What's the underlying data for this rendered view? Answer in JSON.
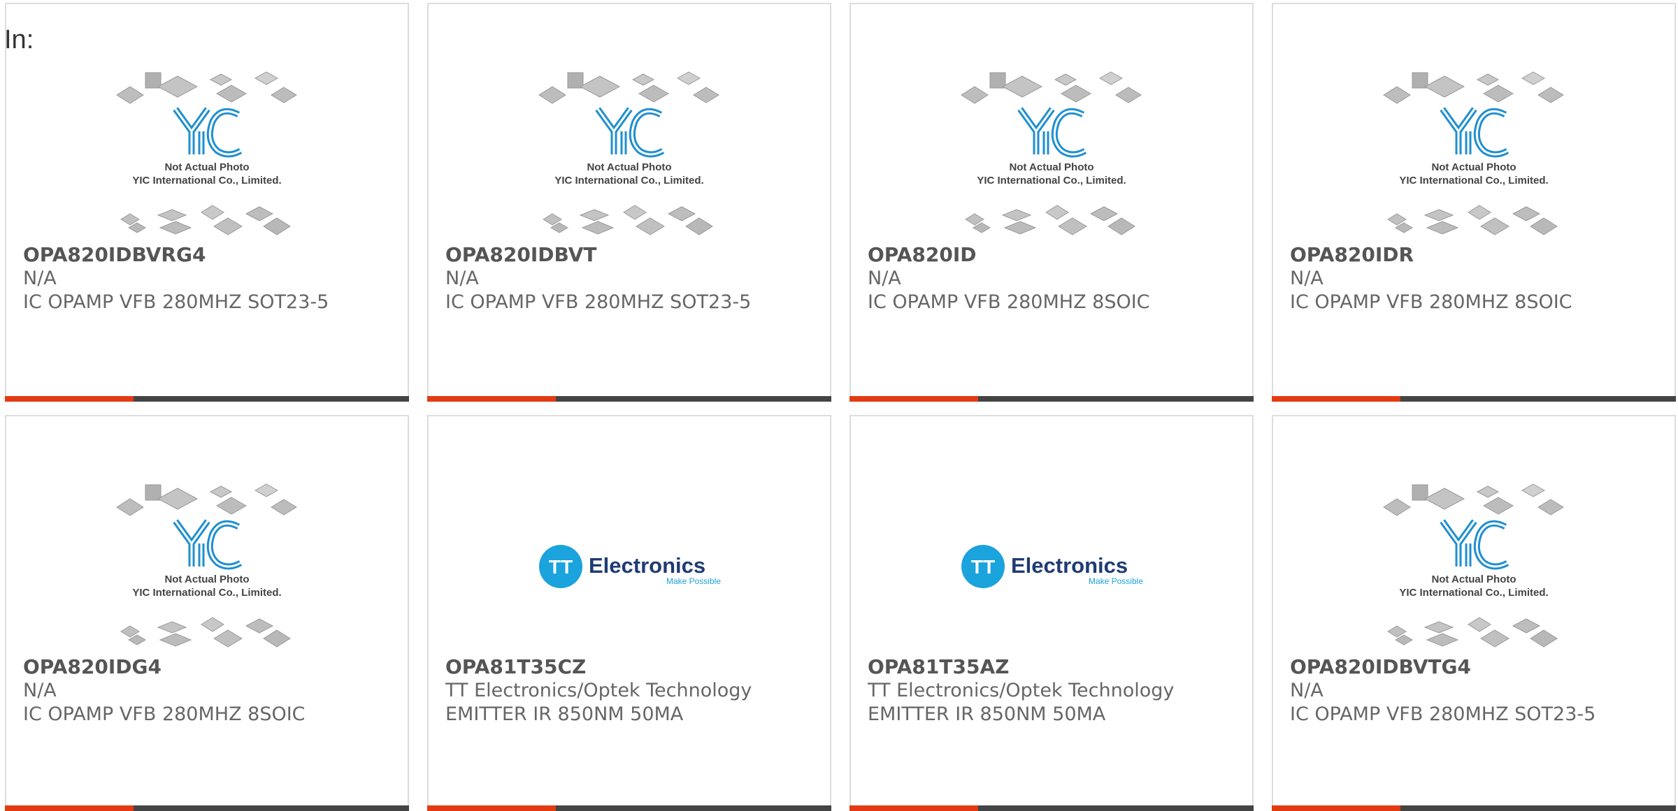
{
  "filter_label": "In:",
  "placeholder_image": {
    "caption_line1": "Not Actual Photo",
    "caption_line2": "YIC International Co., Limited.",
    "logo_text": "YIC"
  },
  "tt_logo": {
    "badge": "TT",
    "name": "Electronics",
    "tagline": "Make Possible"
  },
  "colors": {
    "accent": "#e33a12",
    "bar": "#444444",
    "border": "#dddddd",
    "yic_blue": "#1f8fd0",
    "tt_blue": "#1aa3dc"
  },
  "products": [
    {
      "part": "OPA820IDBVRG4",
      "manufacturer": "N/A",
      "description": "IC OPAMP VFB 280MHZ SOT23-5",
      "image": "yic-placeholder"
    },
    {
      "part": "OPA820IDBVT",
      "manufacturer": "N/A",
      "description": "IC OPAMP VFB 280MHZ SOT23-5",
      "image": "yic-placeholder"
    },
    {
      "part": "OPA820ID",
      "manufacturer": "N/A",
      "description": "IC OPAMP VFB 280MHZ 8SOIC",
      "image": "yic-placeholder"
    },
    {
      "part": "OPA820IDR",
      "manufacturer": "N/A",
      "description": "IC OPAMP VFB 280MHZ 8SOIC",
      "image": "yic-placeholder"
    },
    {
      "part": "OPA820IDG4",
      "manufacturer": "N/A",
      "description": "IC OPAMP VFB 280MHZ 8SOIC",
      "image": "yic-placeholder"
    },
    {
      "part": "OPA81T35CZ",
      "manufacturer": "TT Electronics/Optek Technology",
      "description": "EMITTER IR 850NM 50MA",
      "image": "tt-electronics-logo"
    },
    {
      "part": "OPA81T35AZ",
      "manufacturer": "TT Electronics/Optek Technology",
      "description": "EMITTER IR 850NM 50MA",
      "image": "tt-electronics-logo"
    },
    {
      "part": "OPA820IDBVTG4",
      "manufacturer": "N/A",
      "description": "IC OPAMP VFB 280MHZ SOT23-5",
      "image": "yic-placeholder"
    }
  ]
}
